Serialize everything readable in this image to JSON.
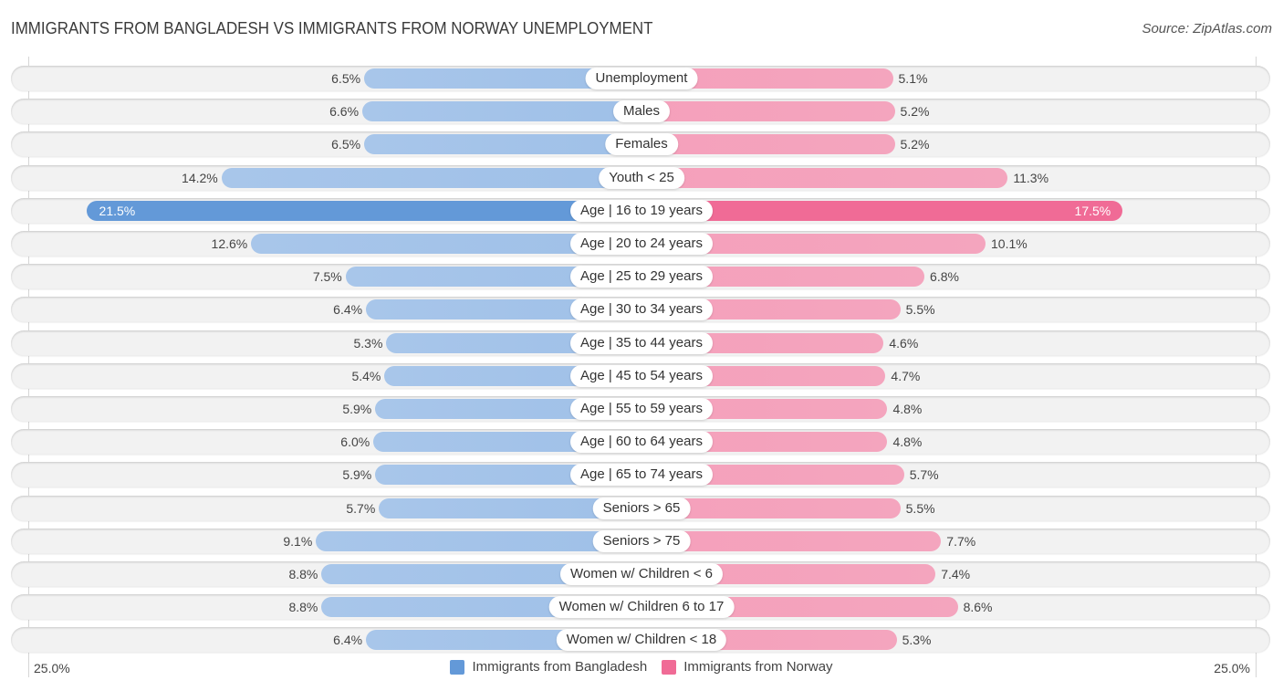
{
  "chart_data": {
    "type": "bar",
    "orientation": "horizontal-diverging",
    "title": "IMMIGRANTS FROM BANGLADESH VS IMMIGRANTS FROM NORWAY UNEMPLOYMENT",
    "source": "Source: ZipAtlas.com",
    "unit": "%",
    "xlim": [
      0,
      25.0
    ],
    "axis_min_label": "25.0%",
    "axis_max_label": "25.0%",
    "legend_position": "bottom",
    "categories": [
      "Unemployment",
      "Males",
      "Females",
      "Youth < 25",
      "Age | 16 to 19 years",
      "Age | 20 to 24 years",
      "Age | 25 to 29 years",
      "Age | 30 to 34 years",
      "Age | 35 to 44 years",
      "Age | 45 to 54 years",
      "Age | 55 to 59 years",
      "Age | 60 to 64 years",
      "Age | 65 to 74 years",
      "Seniors > 65",
      "Seniors > 75",
      "Women w/ Children < 6",
      "Women w/ Children 6 to 17",
      "Women w/ Children < 18"
    ],
    "series": [
      {
        "name": "Immigrants from Bangladesh",
        "side": "left",
        "color": "#6399d8",
        "values": [
          6.5,
          6.6,
          6.5,
          14.2,
          21.5,
          12.6,
          7.5,
          6.4,
          5.3,
          5.4,
          5.9,
          6.0,
          5.9,
          5.7,
          9.1,
          8.8,
          8.8,
          6.4
        ]
      },
      {
        "name": "Immigrants from Norway",
        "side": "right",
        "color": "#f06b96",
        "values": [
          5.1,
          5.2,
          5.2,
          11.3,
          17.5,
          10.1,
          6.8,
          5.5,
          4.6,
          4.7,
          4.8,
          4.8,
          5.7,
          5.5,
          7.7,
          7.4,
          8.6,
          5.3
        ]
      }
    ],
    "highlighted_category": "Age | 16 to 19 years"
  }
}
